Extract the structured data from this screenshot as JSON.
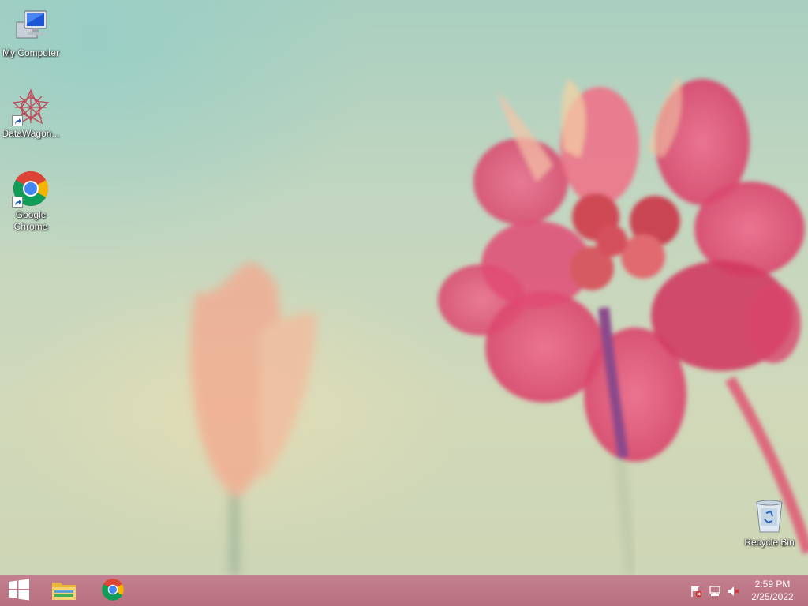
{
  "desktop": {
    "icons": [
      {
        "label": "My Computer",
        "icon": "computer-icon"
      },
      {
        "label": "DataWagon...",
        "icon": "datawagon-icon"
      },
      {
        "label": "Google Chrome",
        "icon": "chrome-icon"
      },
      {
        "label": "Recycle Bin",
        "icon": "recycle-bin-icon"
      }
    ]
  },
  "taskbar": {
    "start": {
      "icon": "windows-logo-icon"
    },
    "pinned": [
      {
        "icon": "file-explorer-icon"
      },
      {
        "icon": "chrome-icon"
      }
    ],
    "tray": [
      {
        "icon": "action-center-flag-icon"
      },
      {
        "icon": "network-icon"
      },
      {
        "icon": "volume-muted-icon"
      }
    ],
    "clock": {
      "time": "2:59 PM",
      "date": "2/25/2022"
    }
  },
  "colors": {
    "taskbar": "#bd7686",
    "flower_pink": "#e0456f"
  }
}
